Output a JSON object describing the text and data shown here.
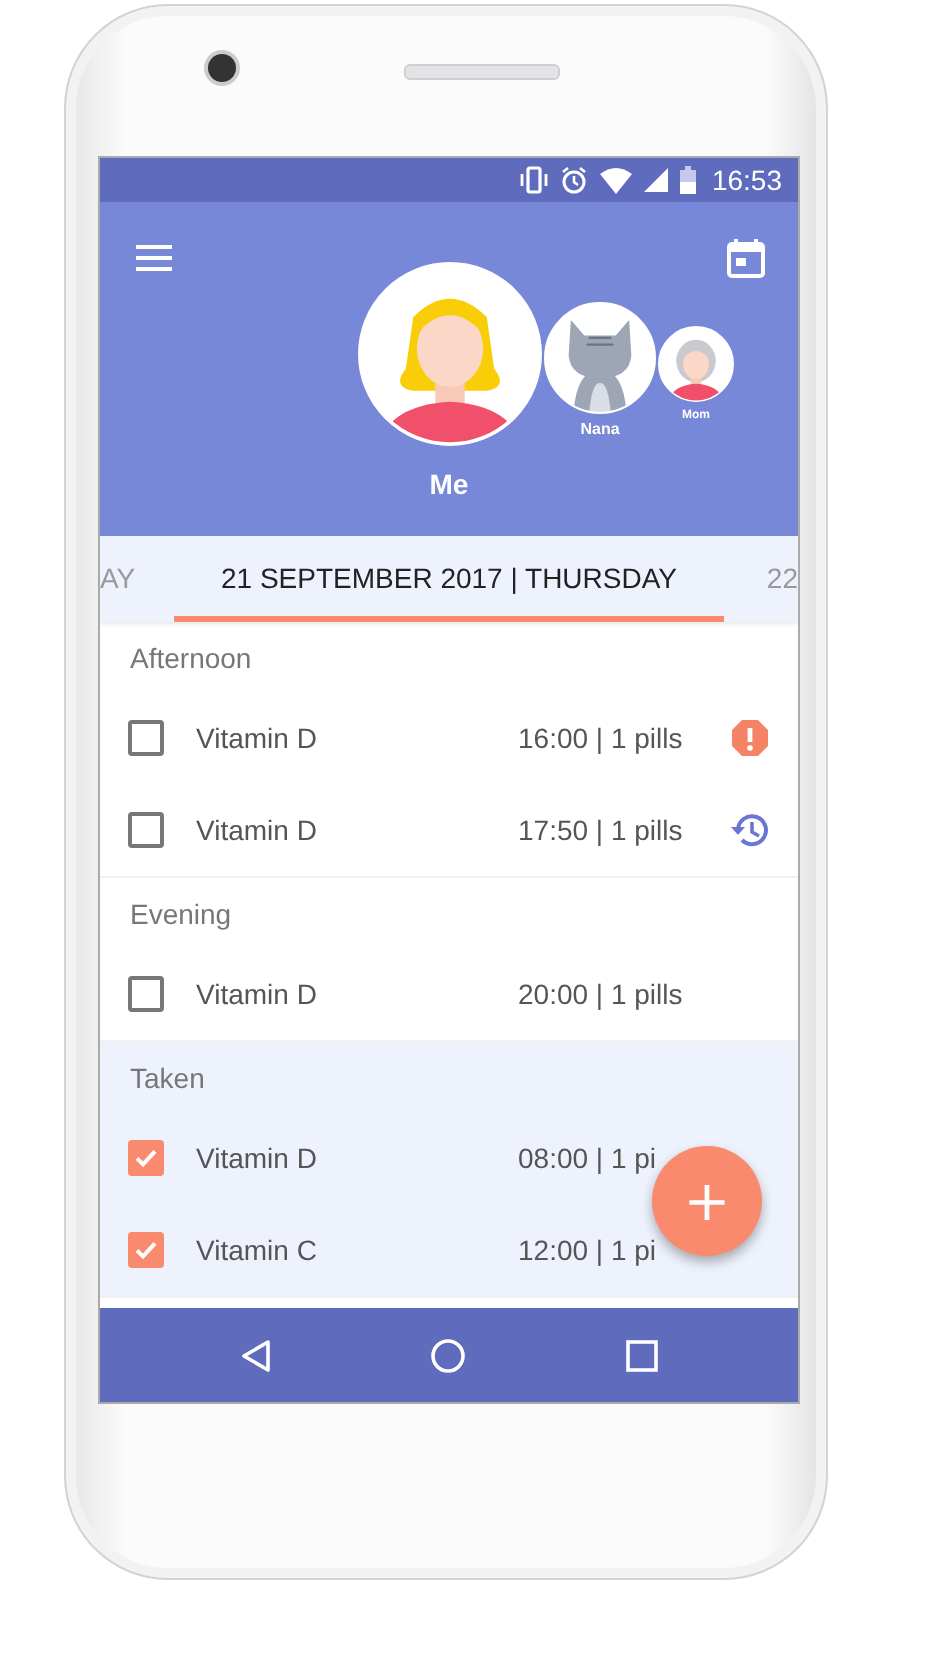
{
  "status_bar": {
    "time": "16:53"
  },
  "profiles": [
    {
      "name": "Me",
      "kind": "woman",
      "selected": true
    },
    {
      "name": "Nana",
      "kind": "cat",
      "selected": false
    },
    {
      "name": "Mom",
      "kind": "elder",
      "selected": false
    }
  ],
  "date_tabs": [
    {
      "label": "AY",
      "selected": false
    },
    {
      "label": "21 SEPTEMBER 2017 | THURSDAY",
      "selected": true
    },
    {
      "label": "22",
      "selected": false
    }
  ],
  "sections": [
    {
      "title": "Afternoon",
      "taken": false,
      "items": [
        {
          "name": "Vitamin D",
          "schedule": "16:00 | 1 pills",
          "checked": false,
          "overdue": true,
          "snoozed": false
        },
        {
          "name": "Vitamin D",
          "schedule": "17:50 | 1 pills",
          "checked": false,
          "overdue": false,
          "snoozed": true
        }
      ]
    },
    {
      "title": "Evening",
      "taken": false,
      "items": [
        {
          "name": "Vitamin D",
          "schedule": "20:00 | 1 pills",
          "checked": false,
          "overdue": false,
          "snoozed": false
        }
      ]
    },
    {
      "title": "Taken",
      "taken": true,
      "items": [
        {
          "name": "Vitamin D",
          "schedule": "08:00 | 1 pi",
          "checked": true,
          "overdue": false,
          "snoozed": false
        },
        {
          "name": "Vitamin C",
          "schedule": "12:00 | 1 pi",
          "checked": true,
          "overdue": false,
          "snoozed": false
        }
      ]
    }
  ],
  "fab": {
    "label": "+"
  }
}
